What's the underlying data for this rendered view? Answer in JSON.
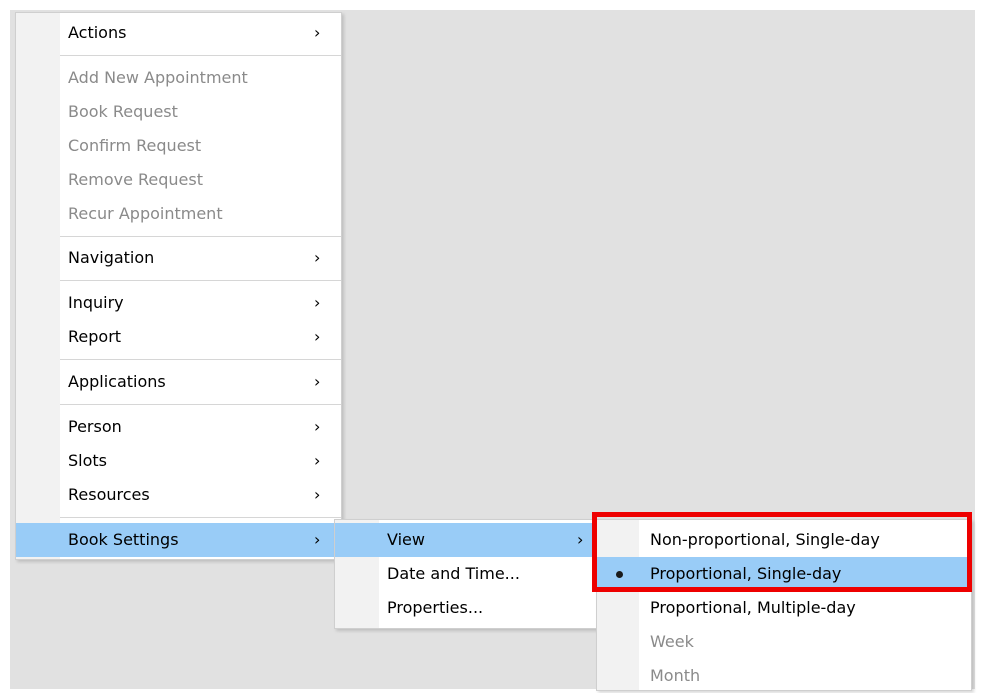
{
  "main_menu": {
    "items": [
      {
        "label": "Actions",
        "has_submenu": true,
        "enabled": true
      },
      {
        "label": "Add New Appointment",
        "has_submenu": false,
        "enabled": false
      },
      {
        "label": "Book Request",
        "has_submenu": false,
        "enabled": false
      },
      {
        "label": "Confirm Request",
        "has_submenu": false,
        "enabled": false
      },
      {
        "label": "Remove Request",
        "has_submenu": false,
        "enabled": false
      },
      {
        "label": "Recur Appointment",
        "has_submenu": false,
        "enabled": false
      },
      {
        "label": "Navigation",
        "has_submenu": true,
        "enabled": true
      },
      {
        "label": "Inquiry",
        "has_submenu": true,
        "enabled": true
      },
      {
        "label": "Report",
        "has_submenu": true,
        "enabled": true
      },
      {
        "label": "Applications",
        "has_submenu": true,
        "enabled": true
      },
      {
        "label": "Person",
        "has_submenu": true,
        "enabled": true
      },
      {
        "label": "Slots",
        "has_submenu": true,
        "enabled": true
      },
      {
        "label": "Resources",
        "has_submenu": true,
        "enabled": true
      },
      {
        "label": "Book Settings",
        "has_submenu": true,
        "enabled": true,
        "highlighted": true
      }
    ]
  },
  "book_settings_menu": {
    "items": [
      {
        "label": "View",
        "has_submenu": true,
        "highlighted": true
      },
      {
        "label": "Date and Time...",
        "has_submenu": false
      },
      {
        "label": "Properties...",
        "has_submenu": false
      }
    ]
  },
  "view_menu": {
    "items": [
      {
        "label": "Non-proportional, Single-day",
        "enabled": true,
        "selected": false
      },
      {
        "label": "Proportional, Single-day",
        "enabled": true,
        "selected": true,
        "highlighted": true
      },
      {
        "label": "Proportional, Multiple-day",
        "enabled": true,
        "selected": false
      },
      {
        "label": "Week",
        "enabled": false,
        "selected": false
      },
      {
        "label": "Month",
        "enabled": false,
        "selected": false
      }
    ]
  },
  "icons": {
    "submenu_arrow": "chevron-right-icon",
    "selected_marker": "radio-bullet-icon"
  },
  "colors": {
    "highlight": "#99ccf7",
    "annotation_box": "#ee0000",
    "disabled_text": "#8a8a8a"
  }
}
